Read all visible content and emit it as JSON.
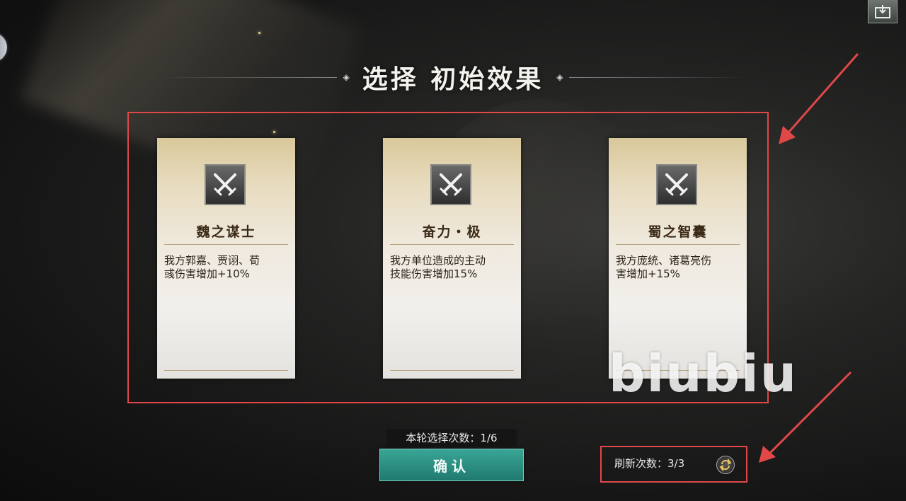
{
  "title": "选择 初始效果",
  "cards": [
    {
      "name": "魏之谋士",
      "desc_line1": "我方郭嘉、贾诩、荀",
      "desc_line2": "彧伤害增加+10%",
      "icon": "crossed-swords-icon"
    },
    {
      "name": "奋力・极",
      "desc_line1": "我方单位造成的主动",
      "desc_line2": "技能伤害增加15%",
      "icon": "crossed-swords-icon"
    },
    {
      "name": "蜀之智囊",
      "desc_line1": "我方庞统、诸葛亮伤",
      "desc_line2": "害增加+15%",
      "icon": "crossed-swords-icon"
    }
  ],
  "round_selection_count": "本轮选择次数：1/6",
  "confirm_label": "确认",
  "refresh_count": "刷新次数：3/3",
  "watermark": "biubiu",
  "colors": {
    "accent_confirm": "#2a8f82",
    "annotation_red": "#e04848",
    "card_title": "#3a2a16"
  }
}
